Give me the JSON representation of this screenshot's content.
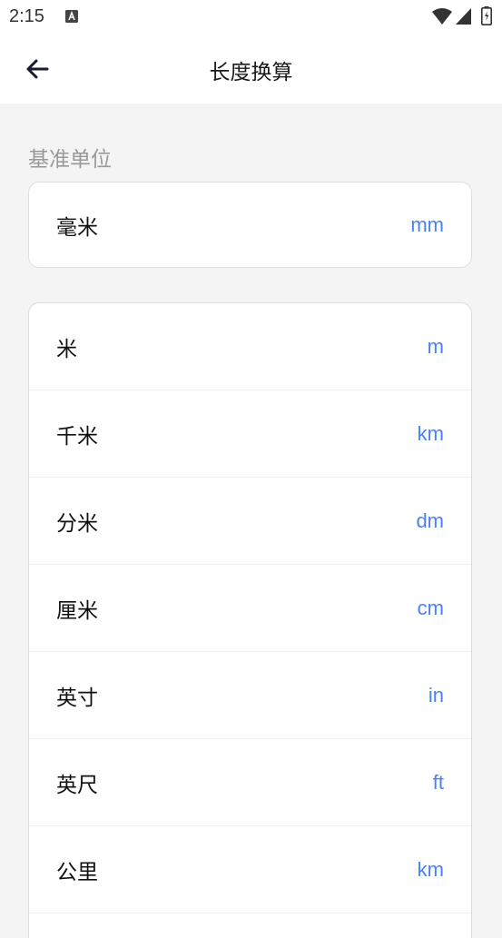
{
  "status_bar": {
    "time": "2:15",
    "notification_icon": "a-box-icon",
    "wifi_icon": "wifi-icon",
    "signal_icon": "signal-icon",
    "battery_icon": "battery-charging-icon"
  },
  "app_bar": {
    "title": "长度换算",
    "back_icon": "arrow-left-icon"
  },
  "base_unit": {
    "label": "基准单位",
    "name": "毫米",
    "abbr": "mm"
  },
  "units": [
    {
      "name": "米",
      "abbr": "m"
    },
    {
      "name": "千米",
      "abbr": "km"
    },
    {
      "name": "分米",
      "abbr": "dm"
    },
    {
      "name": "厘米",
      "abbr": "cm"
    },
    {
      "name": "英寸",
      "abbr": "in"
    },
    {
      "name": "英尺",
      "abbr": "ft"
    },
    {
      "name": "公里",
      "abbr": "km"
    }
  ],
  "colors": {
    "accent": "#4a82f4",
    "background": "#f4f4f4"
  }
}
